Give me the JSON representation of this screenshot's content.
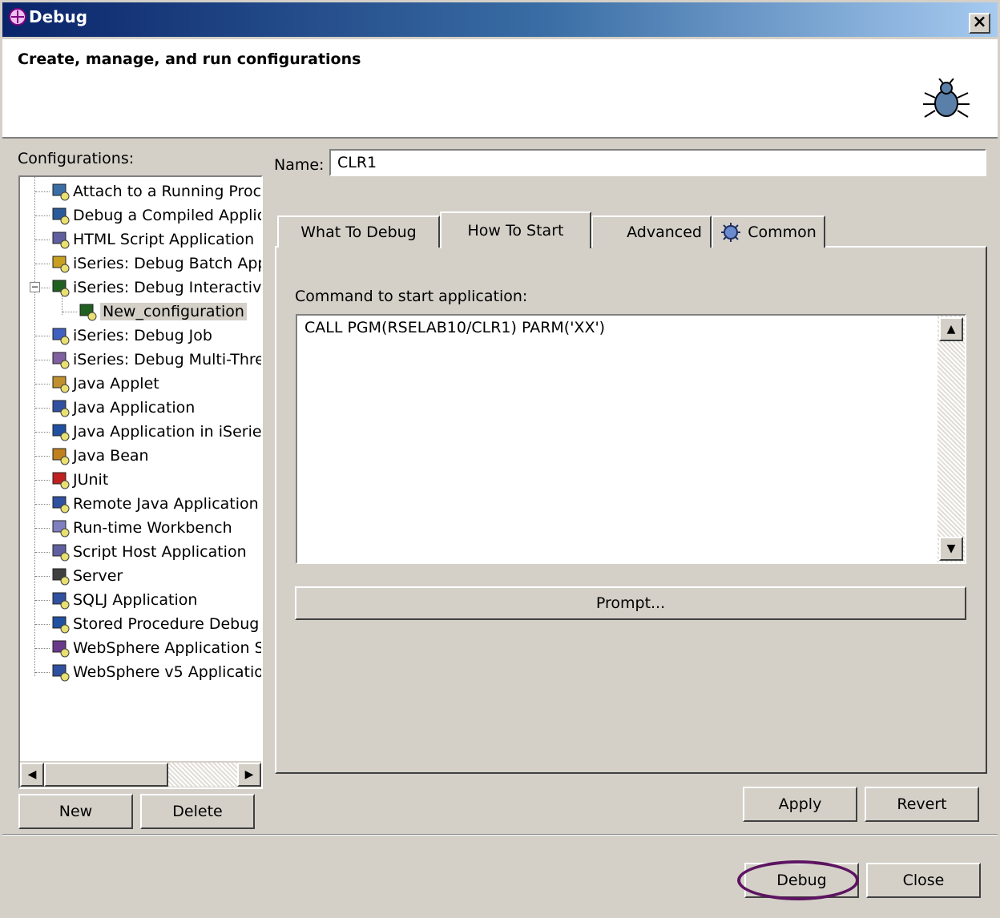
{
  "window": {
    "title": "Debug",
    "close_glyph": "×"
  },
  "banner": {
    "heading": "Create, manage, and run configurations",
    "icon": "bug-icon"
  },
  "configurations": {
    "label": "Configurations:",
    "items": [
      {
        "label": "Attach to a Running Proc",
        "icon": "monitor-icon"
      },
      {
        "label": "Debug a Compiled Applic",
        "icon": "compiled-app-icon"
      },
      {
        "label": "HTML Script Application",
        "icon": "script-icon"
      },
      {
        "label": "iSeries: Debug Batch App",
        "icon": "batch-icon"
      },
      {
        "label": "iSeries: Debug Interactiv",
        "icon": "interactive-icon",
        "expanded": true
      },
      {
        "label": "New_configuration",
        "icon": "interactive-icon",
        "selected": true
      },
      {
        "label": "iSeries: Debug Job",
        "icon": "gears-icon"
      },
      {
        "label": "iSeries: Debug Multi-Thre",
        "icon": "multithread-icon"
      },
      {
        "label": "Java Applet",
        "icon": "applet-icon"
      },
      {
        "label": "Java Application",
        "icon": "java-app-icon"
      },
      {
        "label": "Java Application in iSerie",
        "icon": "java-iseries-icon"
      },
      {
        "label": "Java Bean",
        "icon": "bean-icon"
      },
      {
        "label": "JUnit",
        "icon": "junit-icon"
      },
      {
        "label": "Remote Java Application",
        "icon": "remote-java-icon"
      },
      {
        "label": "Run-time Workbench",
        "icon": "workbench-icon"
      },
      {
        "label": "Script Host Application",
        "icon": "script-host-icon"
      },
      {
        "label": "Server",
        "icon": "server-icon"
      },
      {
        "label": "SQLJ Application",
        "icon": "sqlj-icon"
      },
      {
        "label": "Stored Procedure Debug",
        "icon": "stored-proc-icon"
      },
      {
        "label": "WebSphere Application S",
        "icon": "websphere-icon"
      },
      {
        "label": "WebSphere v5 Applicatio",
        "icon": "websphere5-icon"
      }
    ],
    "new_button": "New",
    "delete_button": "Delete"
  },
  "name": {
    "label": "Name:",
    "value": "CLR1"
  },
  "tabs": [
    {
      "label": "What To Debug",
      "active": false
    },
    {
      "label": "How To Start",
      "active": true
    },
    {
      "label": "Advanced",
      "active": false
    },
    {
      "label": "Common",
      "active": false,
      "icon": "common-gear-icon"
    }
  ],
  "how_to_start": {
    "command_label": "Command to start application:",
    "command_value": "CALL PGM(RSELAB10/CLR1) PARM('XX')",
    "prompt_button": "Prompt..."
  },
  "actions": {
    "apply": "Apply",
    "revert": "Revert",
    "debug": "Debug",
    "close": "Close"
  }
}
